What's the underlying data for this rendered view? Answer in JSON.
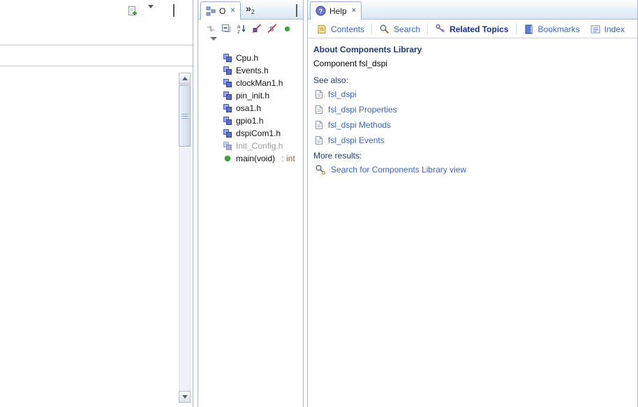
{
  "colors": {
    "accent_link": "#3b66c4",
    "heading": "#1f3a7a",
    "return_type": "#a35a2a",
    "tab_border": "#8fb0d8"
  },
  "icons": {
    "close": "×",
    "overflow_chevron": "»",
    "overflow_count": "2"
  },
  "left_panel": {
    "toolbar_icons": [
      "new-item-icon",
      "view-menu-icon",
      "minimize-icon",
      "maximize-icon"
    ]
  },
  "outline": {
    "tab": {
      "label": "O"
    },
    "toolbar_icons": [
      "link-with-editor-icon",
      "collapse-all-icon",
      "sort-icon",
      "hide-fields-icon",
      "hide-static-icon",
      "show-public-icon"
    ],
    "items": [
      {
        "label": "Cpu.h"
      },
      {
        "label": "Events.h"
      },
      {
        "label": "clockMan1.h"
      },
      {
        "label": "pin_init.h"
      },
      {
        "label": "osa1.h"
      },
      {
        "label": "gpio1.h"
      },
      {
        "label": "dspiCom1.h"
      },
      {
        "label": "Init_Config.h",
        "disabled": true
      },
      {
        "label": "main(void)",
        "suffix": " : int"
      }
    ]
  },
  "help": {
    "tab": {
      "label": "Help"
    },
    "toolbar": [
      {
        "label": "Contents"
      },
      {
        "label": "Search"
      },
      {
        "label": "Related Topics",
        "active": true
      },
      {
        "label": "Bookmarks"
      },
      {
        "label": "Index"
      }
    ],
    "content": {
      "title": "About Components Library",
      "component_line": "Component fsl_dspi",
      "see_also_label": "See also:",
      "links": [
        {
          "label": "fsl_dspi"
        },
        {
          "label": "fsl_dspi Properties"
        },
        {
          "label": "fsl_dspi Methods"
        },
        {
          "label": "fsl_dspi Events"
        }
      ],
      "more_results_label": "More results:",
      "search_link": "Search for Components Library view"
    }
  }
}
